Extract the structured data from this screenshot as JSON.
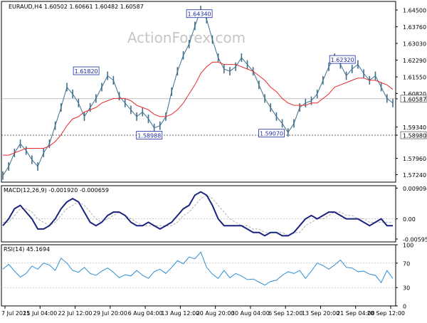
{
  "chart_data": {
    "type": "line",
    "price_panel": {
      "header": "EURAUD,H4  1.60502 1.60661 1.60482 1.60587",
      "watermark": "ActionForex.com",
      "ylim": [
        1.5691,
        1.6488
      ],
      "y_ticks": [
        "1.64500",
        "1.63760",
        "1.63030",
        "1.62290",
        "1.61550",
        "1.60820",
        "1.60587",
        "1.59340",
        "1.58980",
        "1.57960",
        "1.57240"
      ],
      "y_tick_values": [
        1.645,
        1.6376,
        1.6303,
        1.6229,
        1.6155,
        1.6082,
        1.60587,
        1.5934,
        1.5898,
        1.5796,
        1.5724
      ],
      "current_price": 1.60587,
      "current_label": "1.60587",
      "support_level": 1.5898,
      "support_label": "1.58980",
      "annotations": [
        {
          "label": "1.61820",
          "value": 1.6182,
          "x_frac": 0.215
        },
        {
          "label": "1.58988",
          "value": 1.5898,
          "x_frac": 0.375
        },
        {
          "label": "1.64340",
          "value": 1.6434,
          "x_frac": 0.502
        },
        {
          "label": "1.59070",
          "value": 1.5907,
          "x_frac": 0.685
        },
        {
          "label": "1.62320",
          "value": 1.6232,
          "x_frac": 0.865
        }
      ],
      "series": [
        {
          "values": [
            1.572,
            1.576,
            1.582,
            1.586,
            1.583,
            1.579,
            1.576,
            1.582,
            1.586,
            1.594,
            1.602,
            1.611,
            1.608,
            1.604,
            1.598,
            1.602,
            1.606,
            1.611,
            1.616,
            1.614,
            1.607,
            1.604,
            1.601,
            1.598,
            1.6,
            1.597,
            1.593,
            1.594,
            1.598,
            1.609,
            1.618,
            1.625,
            1.63,
            1.638,
            1.645,
            1.641,
            1.632,
            1.624,
            1.619,
            1.618,
            1.62,
            1.624,
            1.621,
            1.618,
            1.612,
            1.606,
            1.602,
            1.598,
            1.595,
            1.591,
            1.595,
            1.602,
            1.604,
            1.605,
            1.608,
            1.614,
            1.62,
            1.624,
            1.621,
            1.616,
            1.619,
            1.621,
            1.617,
            1.614,
            1.616,
            1.611,
            1.606,
            1.604
          ]
        },
        {
          "values": [
            1.581,
            1.581,
            1.582,
            1.583,
            1.584,
            1.584,
            1.584,
            1.584,
            1.585,
            1.587,
            1.59,
            1.594,
            1.597,
            1.598,
            1.6,
            1.601,
            1.602,
            1.604,
            1.605,
            1.606,
            1.606,
            1.606,
            1.605,
            1.603,
            1.602,
            1.601,
            1.599,
            1.598,
            1.598,
            1.599,
            1.601,
            1.604,
            1.608,
            1.612,
            1.617,
            1.62,
            1.622,
            1.622,
            1.621,
            1.621,
            1.621,
            1.62,
            1.619,
            1.618,
            1.616,
            1.614,
            1.611,
            1.609,
            1.606,
            1.604,
            1.603,
            1.603,
            1.603,
            1.604,
            1.604,
            1.606,
            1.608,
            1.611,
            1.612,
            1.613,
            1.614,
            1.615,
            1.615,
            1.614,
            1.614,
            1.613,
            1.612,
            1.61
          ]
        }
      ]
    },
    "macd_panel": {
      "header": "MACD(12,26,9) -0.001920 -0.000659",
      "ylim": [
        -0.0068,
        0.0098
      ],
      "y_ticks": [
        "0.009094",
        "0.00",
        "-0.005956"
      ],
      "y_tick_values": [
        0.009094,
        0.0,
        -0.005956
      ],
      "series": [
        {
          "values": [
            -0.002,
            0.0,
            0.003,
            0.004,
            0.002,
            0.0,
            -0.003,
            -0.003,
            -0.002,
            0.0,
            0.003,
            0.005,
            0.006,
            0.005,
            0.002,
            -0.001,
            -0.002,
            -0.001,
            0.001,
            0.002,
            0.002,
            0.001,
            -0.001,
            -0.002,
            -0.002,
            -0.001,
            -0.002,
            -0.003,
            -0.002,
            -0.001,
            0.001,
            0.003,
            0.004,
            0.007,
            0.008,
            0.007,
            0.004,
            0.0,
            -0.002,
            -0.002,
            -0.002,
            -0.002,
            -0.003,
            -0.004,
            -0.004,
            -0.005,
            -0.004,
            -0.004,
            -0.005,
            -0.005,
            -0.004,
            -0.002,
            0.0,
            0.001,
            0.0,
            0.001,
            0.002,
            0.002,
            0.001,
            0.0,
            0.0,
            0.0,
            -0.001,
            -0.002,
            -0.001,
            0.0,
            -0.002,
            -0.002
          ]
        },
        {
          "values": [
            -0.001,
            -0.001,
            0.001,
            0.003,
            0.003,
            0.002,
            0.0,
            -0.001,
            -0.002,
            -0.001,
            0.001,
            0.003,
            0.004,
            0.005,
            0.004,
            0.002,
            0.0,
            -0.001,
            0.0,
            0.001,
            0.002,
            0.001,
            0.0,
            -0.001,
            -0.002,
            -0.002,
            -0.002,
            -0.002,
            -0.002,
            -0.002,
            -0.001,
            0.001,
            0.002,
            0.004,
            0.006,
            0.007,
            0.006,
            0.004,
            0.002,
            0.0,
            -0.001,
            -0.002,
            -0.002,
            -0.003,
            -0.003,
            -0.004,
            -0.004,
            -0.004,
            -0.004,
            -0.005,
            -0.004,
            -0.004,
            -0.002,
            -0.001,
            0.0,
            0.0,
            0.001,
            0.002,
            0.002,
            0.001,
            0.001,
            0.0,
            0.0,
            -0.001,
            -0.001,
            -0.001,
            -0.001,
            -0.001
          ]
        }
      ]
    },
    "rsi_panel": {
      "header": "RSI(14) 45.1694",
      "ylim": [
        0,
        100
      ],
      "y_ticks": [
        "100",
        "70",
        "30",
        "0"
      ],
      "y_tick_values": [
        100,
        70,
        30,
        0
      ],
      "levels": [
        70,
        30
      ],
      "series": [
        {
          "values": [
            60,
            68,
            57,
            47,
            53,
            65,
            60,
            70,
            67,
            58,
            78,
            70,
            58,
            55,
            63,
            53,
            50,
            57,
            62,
            55,
            46,
            51,
            49,
            58,
            50,
            45,
            56,
            60,
            53,
            63,
            74,
            69,
            80,
            77,
            88,
            63,
            52,
            45,
            58,
            46,
            53,
            49,
            43,
            44,
            39,
            34,
            40,
            42,
            50,
            56,
            53,
            58,
            45,
            57,
            70,
            66,
            60,
            67,
            75,
            63,
            62,
            56,
            57,
            52,
            50,
            38,
            58,
            45
          ]
        }
      ]
    },
    "x_ticks": [
      "7 Jul 2021",
      "15 Jul 04:00",
      "22 Jul 12:00",
      "29 Jul 20:00",
      "6 Aug 04:00",
      "13 Aug 12:00",
      "20 Aug 20:00",
      "30 Aug 04:00",
      "6 Sep 12:00",
      "13 Sep 20:00",
      "21 Sep 04:00",
      "28 Sep 12:00"
    ],
    "grid": false
  },
  "colors": {
    "price": "#3f6f8c",
    "ma": "#e82c2c",
    "macd": "#1a237e",
    "signal": "#b0b0b0",
    "rsi": "#2c8ed6",
    "axis": "#000000",
    "watermark": "#c6c6c6",
    "label_border": "#1c2ba0"
  }
}
